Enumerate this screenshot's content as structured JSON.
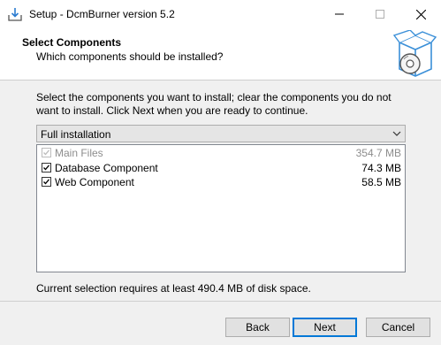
{
  "window": {
    "title": "Setup - DcmBurner version 5.2"
  },
  "header": {
    "title": "Select Components",
    "subtitle": "Which components should be installed?"
  },
  "description": "Select the components you want to install; clear the components you do not want to install. Click Next when you are ready to continue.",
  "install_type": {
    "selected": "Full installation"
  },
  "components": [
    {
      "label": "Main Files",
      "size": "354.7 MB",
      "checked": true,
      "enabled": false
    },
    {
      "label": "Database Component",
      "size": "74.3 MB",
      "checked": true,
      "enabled": true
    },
    {
      "label": "Web Component",
      "size": "58.5 MB",
      "checked": true,
      "enabled": true
    }
  ],
  "disk_space_text": "Current selection requires at least 490.4 MB of disk space.",
  "buttons": {
    "back": "Back",
    "next": "Next",
    "cancel": "Cancel"
  }
}
